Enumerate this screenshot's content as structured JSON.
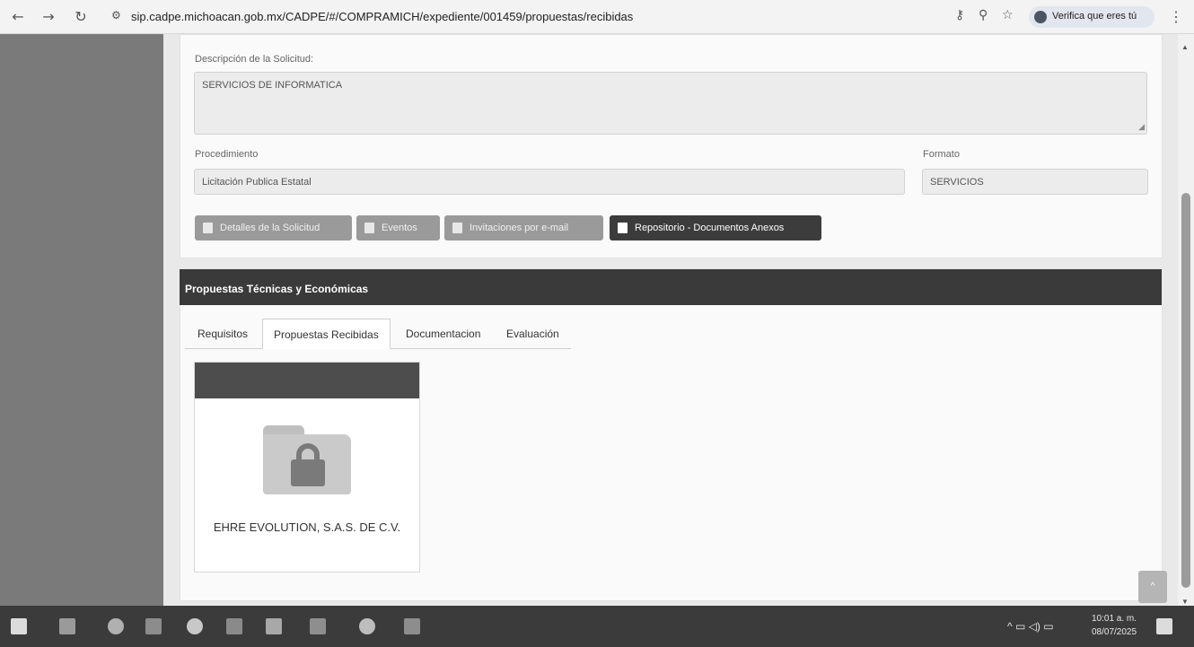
{
  "browser": {
    "url": "sip.cadpe.michoacan.gob.mx/CADPE/#/COMPRAMICH/expediente/001459/propuestas/recibidas",
    "verify_label": "Verifica que eres tú"
  },
  "request": {
    "description_label": "Descripción de la Solicitud:",
    "description_value": "SERVICIOS DE INFORMATICA",
    "procedure_label": "Procedimiento",
    "procedure_value": "Licitación Publica Estatal",
    "format_label": "Formato",
    "format_value": "SERVICIOS"
  },
  "buttons": {
    "details": "Detalles de la Solicitud",
    "events": "Eventos",
    "invitations": "Invitaciones por e-mail",
    "repository": "Repositorio - Documentos Anexos"
  },
  "section": {
    "title": "Propuestas Técnicas y Económicas"
  },
  "tabs": [
    {
      "label": "Requisitos"
    },
    {
      "label": "Propuestas Recibidas"
    },
    {
      "label": "Documentacion"
    },
    {
      "label": "Evaluación"
    }
  ],
  "active_tab": "Propuestas Recibidas",
  "proposals": [
    {
      "name": "EHRE EVOLUTION, S.A.S. DE C.V."
    }
  ],
  "taskbar": {
    "time": "10:01 a. m.",
    "date": "08/07/2025"
  },
  "colors": {
    "section_header": "#3a3a3a",
    "button_dark": "#3c3c3c",
    "button_gray": "#9a9a9a"
  }
}
